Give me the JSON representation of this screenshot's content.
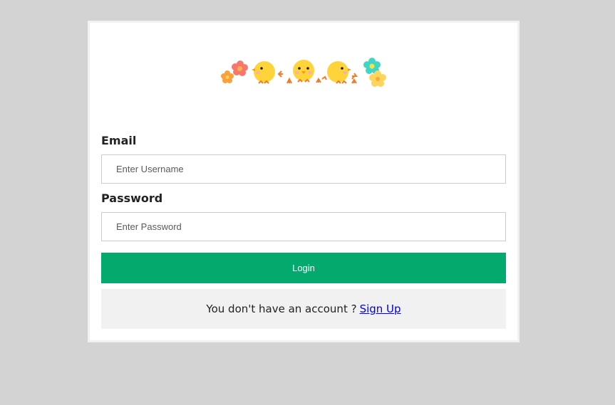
{
  "form": {
    "email_label": "Email",
    "username_placeholder": "Enter Username",
    "username_value": "",
    "password_label": "Password",
    "password_placeholder": "Enter Password",
    "password_value": "",
    "login_label": "Login"
  },
  "signup": {
    "prompt": "You don't have an account ?",
    "link_label": "Sign Up"
  },
  "colors": {
    "page_bg": "#d3d3d3",
    "card_bg": "#ffffff",
    "login_button": "#04aa6d",
    "signup_box_bg": "#f1f1f1",
    "link": "#0000ee"
  },
  "icons": [
    "pink-flower-icon",
    "chick-icon",
    "chick-icon",
    "chick-icon",
    "cyan-flower-icon",
    "yellow-flower-icon",
    "footprint-icon"
  ]
}
